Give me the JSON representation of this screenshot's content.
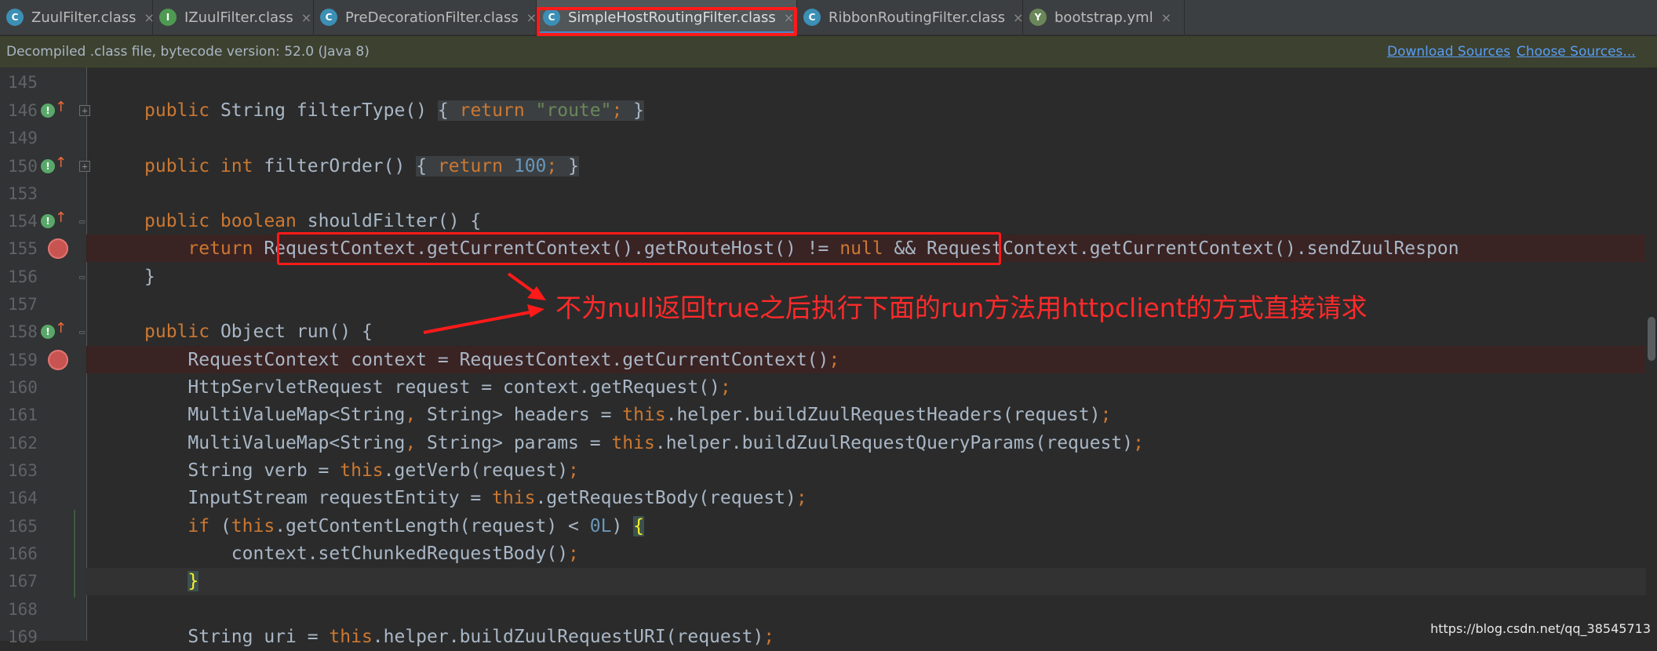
{
  "tabs": [
    {
      "label": "ZuulFilter.class",
      "icon": "class-icon",
      "active": false
    },
    {
      "label": "IZuulFilter.class",
      "icon": "interface-icon",
      "active": false
    },
    {
      "label": "PreDecorationFilter.class",
      "icon": "class-icon",
      "active": false
    },
    {
      "label": "SimpleHostRoutingFilter.class",
      "icon": "class-icon",
      "active": true
    },
    {
      "label": "RibbonRoutingFilter.class",
      "icon": "class-icon",
      "active": false
    },
    {
      "label": "bootstrap.yml",
      "icon": "yaml-icon",
      "active": false
    }
  ],
  "infobar": {
    "text": "Decompiled .class file, bytecode version: 52.0 (Java 8)",
    "download_sources": "Download Sources",
    "choose_sources": "Choose Sources..."
  },
  "line_numbers": [
    "145",
    "146",
    "149",
    "150",
    "153",
    "154",
    "155",
    "156",
    "157",
    "158",
    "159",
    "160",
    "161",
    "162",
    "163",
    "164",
    "165",
    "166",
    "167",
    "168",
    "169"
  ],
  "annotation": {
    "text": "不为null返回true之后执行下面的run方法用httpclient的方式直接请求",
    "color": "#ff2a2a"
  },
  "watermark": "https://blog.csdn.net/qq_38545713",
  "colors": {
    "background": "#2b2b2b",
    "keyword": "#cc7832",
    "string": "#6a8759",
    "number": "#6897bb",
    "highlight_box": "#ff1a1a"
  }
}
